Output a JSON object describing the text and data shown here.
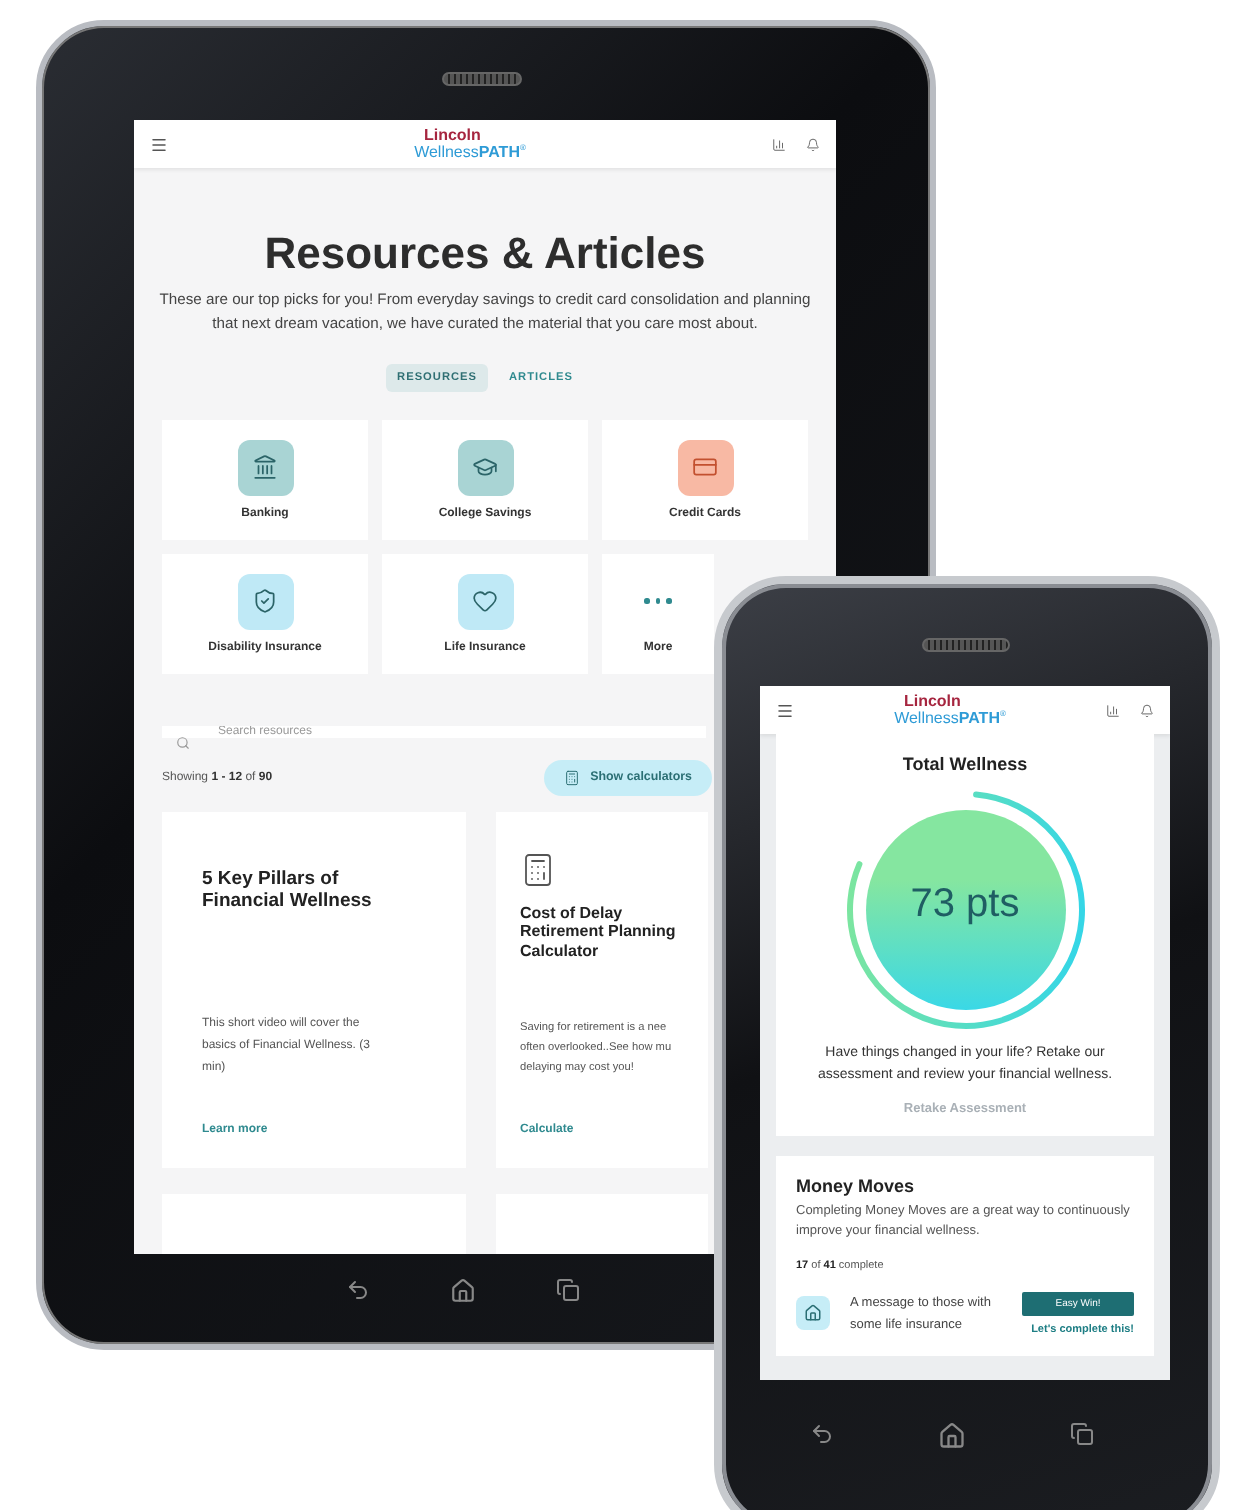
{
  "tablet": {
    "header": {
      "logo_top": "Lincoln",
      "logo_bottom": "Wellness**PATH**$^{®}$"
    },
    "title": "Resources & Articles",
    "intro": "These are our top picks for you! From everyday savings to credit card consolidation and planning that next dream vacation, we have curated the material that you care most about.",
    "tabs": [
      {
        "label": "RESOURCES",
        "selected": true
      },
      {
        "label": "ARTICLES",
        "selected": false
      }
    ],
    "categories": [
      {
        "kind": "bank",
        "label": "Banking",
        "color": "#a9d4d4"
      },
      {
        "kind": "cap",
        "label": "College Savings",
        "color": "#a9d4d4"
      },
      {
        "kind": "cards",
        "label": "Credit Cards",
        "color": "#f8b9a4"
      },
      {
        "kind": "shield",
        "label": "Disability Insurance",
        "color": "#bfe9f6"
      },
      {
        "kind": "heart",
        "label": "Life Insurance",
        "color": "#bfe9f6"
      },
      {
        "kind": "more",
        "label": "More"
      }
    ],
    "search": {
      "placeholder": "Search resources"
    },
    "results": "Showing **1 - 12** of **90**",
    "calculator_toggle": "Show calculators",
    "cards": [
      {
        "kind": "article",
        "title": "5 Key Pillars of Financial Wellness",
        "text": "This short video will cover the basics of Financial Wellness. (3 min)",
        "link": "Learn more"
      },
      {
        "kind": "calculator",
        "title": "Cost of Delay Retirement Planning Calculator",
        "text": "Saving for retirement is a nee\noften overlooked..See how mu\ndelaying may cost you!",
        "link": "Calculate"
      }
    ]
  },
  "phone": {
    "header": {
      "logo_top": "Lincoln",
      "logo_bottom": "Wellness**PATH**$^{®}$"
    },
    "wellness": {
      "title": "Total Wellness",
      "score": "73 pts",
      "level": 0.8,
      "text": "Have things changed in your life? Retake our assessment and review your financial wellness.",
      "button": "Retake Assessment"
    },
    "money_moves": {
      "title": "Money Moves",
      "text": "Completing Money Moves are a great way to continuously improve your financial wellness.",
      "progress": "**17** of **41** complete",
      "items": [
        {
          "text": "A message to those with some life insurance",
          "badge": "Easy Win!",
          "link": "Let's complete this!"
        }
      ]
    }
  }
}
